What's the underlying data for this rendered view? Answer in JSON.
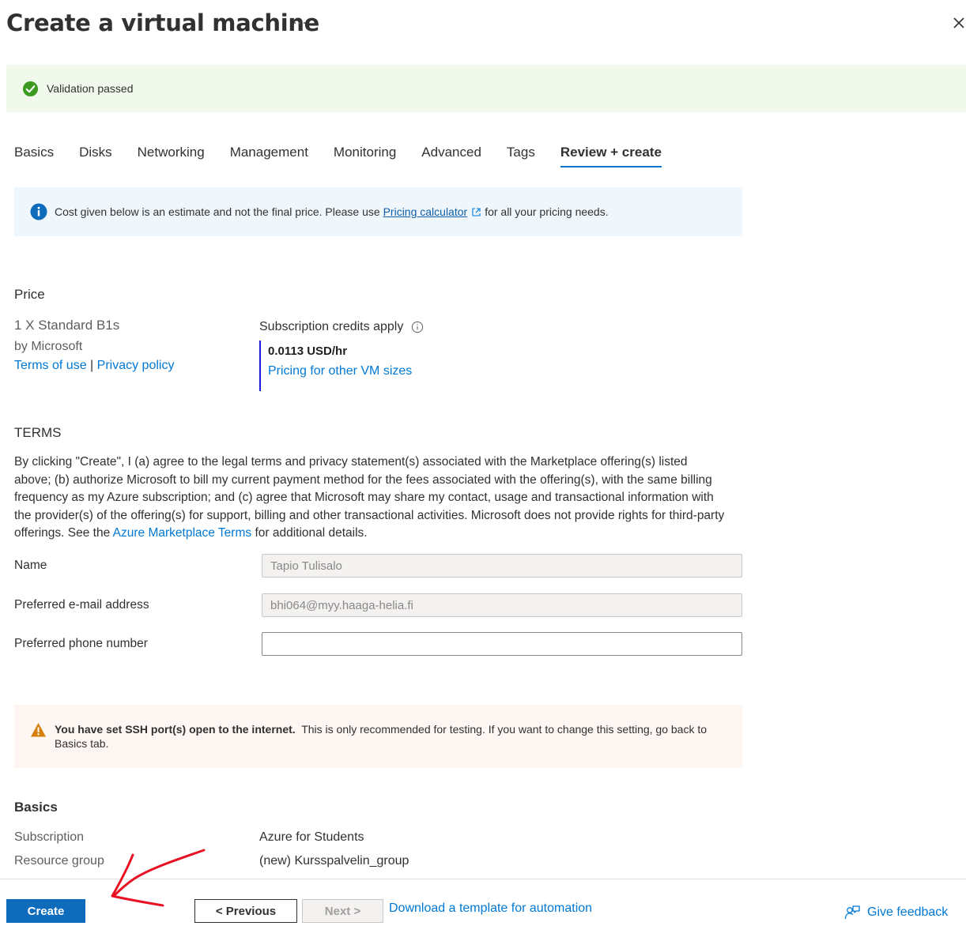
{
  "header": {
    "title": "Create a virtual machine",
    "more_label": "···"
  },
  "validation": {
    "message": "Validation passed"
  },
  "tabs": [
    {
      "label": "Basics"
    },
    {
      "label": "Disks"
    },
    {
      "label": "Networking"
    },
    {
      "label": "Management"
    },
    {
      "label": "Monitoring"
    },
    {
      "label": "Advanced"
    },
    {
      "label": "Tags"
    },
    {
      "label": "Review + create"
    }
  ],
  "info_banner": {
    "text_before": "Cost given below is an estimate and not the final price. Please use",
    "link": "Pricing calculator",
    "text_after": "for all your pricing needs."
  },
  "price": {
    "title": "Price",
    "vm_name": "1 X Standard B1s",
    "publisher": "by Microsoft",
    "terms_link": "Terms of use",
    "separator": "|",
    "privacy_link": "Privacy policy",
    "credits_label": "Subscription credits apply",
    "price_value": "0.0113 USD/hr",
    "other_sizes_link": "Pricing for other VM sizes"
  },
  "terms": {
    "title": "TERMS",
    "text_before": "By clicking \"Create\", I (a) agree to the legal terms and privacy statement(s) associated with the Marketplace offering(s) listed above; (b) authorize Microsoft to bill my current payment method for the fees associated with the offering(s), with the same billing frequency as my Azure subscription; and (c) agree that Microsoft may share my contact, usage and transactional information with the provider(s) of the offering(s) for support, billing and other transactional activities. Microsoft does not provide rights for third-party offerings. See the",
    "link": "Azure Marketplace Terms",
    "text_after": "for additional details."
  },
  "form": {
    "name_label": "Name",
    "name_value": "Tapio Tulisalo",
    "email_label": "Preferred e-mail address",
    "email_value": "bhi064@myy.haaga-helia.fi",
    "phone_label": "Preferred phone number",
    "phone_value": ""
  },
  "warning": {
    "bold": "You have set SSH port(s) open to the internet.",
    "text": "This is only recommended for testing.  If you want to change this setting, go back to Basics tab."
  },
  "basics": {
    "title": "Basics",
    "rows": [
      {
        "label": "Subscription",
        "value": "Azure for Students"
      },
      {
        "label": "Resource group",
        "value": "(new) Kursspalvelin_group"
      }
    ]
  },
  "footer": {
    "create": "Create",
    "previous": "< Previous",
    "next": "Next >",
    "download": "Download a template for automation",
    "feedback": "Give feedback"
  },
  "colors": {
    "accent": "#0078d4",
    "success": "#107c10",
    "warning": "#d83b01",
    "annotation": "#e81123"
  },
  "icons": {
    "validation": "check-circle-icon",
    "info": "info-icon",
    "warning": "warning-icon",
    "external": "external-link-icon",
    "feedback": "feedback-icon",
    "close": "close-icon"
  }
}
